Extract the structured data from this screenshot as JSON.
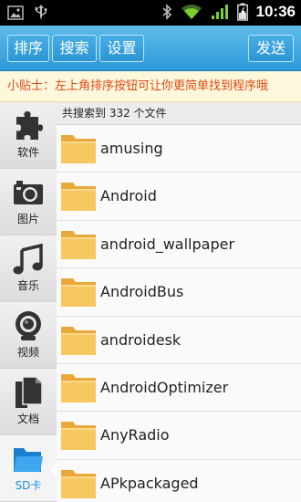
{
  "status_bar": {
    "time": "10:36",
    "icons": [
      "image-notification-icon",
      "usb-icon",
      "bluetooth-icon",
      "wifi-icon",
      "signal-icon",
      "battery-charging-icon"
    ]
  },
  "toolbar": {
    "sort_label": "排序",
    "search_label": "搜索",
    "settings_label": "设置",
    "send_label": "发送"
  },
  "tip": {
    "text": "小贴士：左上角排序按钮可让你更简单找到程序哦"
  },
  "sidebar": {
    "items": [
      {
        "label": "软件",
        "icon": "puzzle-icon"
      },
      {
        "label": "图片",
        "icon": "camera-icon"
      },
      {
        "label": "音乐",
        "icon": "music-note-icon"
      },
      {
        "label": "视频",
        "icon": "webcam-icon"
      },
      {
        "label": "文档",
        "icon": "document-icon"
      },
      {
        "label": "SD卡",
        "icon": "folder-icon",
        "active": true
      }
    ]
  },
  "results": {
    "header": "共搜索到 332 个文件",
    "items": [
      {
        "name": "amusing"
      },
      {
        "name": "Android"
      },
      {
        "name": "android_wallpaper"
      },
      {
        "name": "AndroidBus"
      },
      {
        "name": "androidesk"
      },
      {
        "name": "AndroidOptimizer"
      },
      {
        "name": "AnyRadio"
      },
      {
        "name": "APkpackaged"
      }
    ]
  },
  "colors": {
    "toolbar_blue": "#2d99d8",
    "tip_text": "#e04a14",
    "active_label": "#1b8ee0",
    "folder_yellow": "#f7c760"
  }
}
